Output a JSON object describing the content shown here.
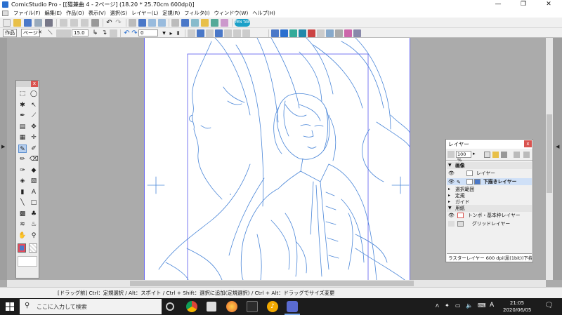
{
  "window": {
    "title": "ComicStudio Pro - [[猫兼曲 4 - 2ページ] (18.20 * 25.70cm 600dpi)]",
    "controls": [
      "—",
      "❐",
      "✕"
    ]
  },
  "menubar": {
    "items": [
      "ファイル(F)",
      "編集(E)",
      "作品(O)",
      "表示(V)",
      "選択(S)",
      "レイヤー(L)",
      "定規(R)",
      "フィルタ(I)",
      "ウィンドウ(W)",
      "ヘルプ(H)"
    ]
  },
  "toolbar": {
    "pentab_label": "PEN TAB",
    "work_tab": "作品",
    "page_tab": "ページ",
    "page_close": "✕",
    "brush_size": "15.0",
    "rotation": "0"
  },
  "tool_palette": {
    "close": "x",
    "tools": [
      {
        "name": "rect-select-icon",
        "glyph": "⬚"
      },
      {
        "name": "lasso-icon",
        "glyph": "◯"
      },
      {
        "name": "magic-wand-icon",
        "glyph": "✱"
      },
      {
        "name": "move-layer-icon",
        "glyph": "↖"
      },
      {
        "name": "pen-icon",
        "glyph": "✒"
      },
      {
        "name": "eyedropper-icon",
        "glyph": "⟋"
      },
      {
        "name": "layer-move-icon",
        "glyph": "▤"
      },
      {
        "name": "object-icon",
        "glyph": "✥"
      },
      {
        "name": "ruler-icon",
        "glyph": "▦"
      },
      {
        "name": "move-icon",
        "glyph": "✛"
      },
      {
        "name": "pencil-icon",
        "glyph": "✎"
      },
      {
        "name": "marker-icon",
        "glyph": "✐"
      },
      {
        "name": "brush-icon",
        "glyph": "✏"
      },
      {
        "name": "eraser-icon",
        "glyph": "⌫"
      },
      {
        "name": "airbrush-icon",
        "glyph": "✑"
      },
      {
        "name": "fill-icon",
        "glyph": "◆"
      },
      {
        "name": "bucket-icon",
        "glyph": "◈"
      },
      {
        "name": "pattern-icon",
        "glyph": "▧"
      },
      {
        "name": "gradient-icon",
        "glyph": "▮"
      },
      {
        "name": "text-icon",
        "glyph": "A"
      },
      {
        "name": "line-icon",
        "glyph": "╲"
      },
      {
        "name": "frame-icon",
        "glyph": "□"
      },
      {
        "name": "tone-icon",
        "glyph": "▩"
      },
      {
        "name": "stamp-icon",
        "glyph": "♣"
      },
      {
        "name": "blur-icon",
        "glyph": "≋"
      },
      {
        "name": "smudge-icon",
        "glyph": "♨"
      },
      {
        "name": "hand-icon",
        "glyph": "✋"
      },
      {
        "name": "zoom-icon",
        "glyph": "⚲"
      }
    ]
  },
  "layer_palette": {
    "title": "レイヤー",
    "close": "x",
    "opacity": "100 %",
    "rows": [
      {
        "label": "画像",
        "kind": "group"
      },
      {
        "label": "レイヤー",
        "kind": "layer"
      },
      {
        "label": "下描きレイヤー",
        "kind": "layer-selected"
      },
      {
        "label": "選択範囲",
        "kind": "group"
      },
      {
        "label": "定規",
        "kind": "group"
      },
      {
        "label": "ガイド",
        "kind": "group"
      },
      {
        "label": "用紙",
        "kind": "group"
      },
      {
        "label": "トンボ・基本枠レイヤー",
        "kind": "layer"
      },
      {
        "label": "グリッドレイヤー",
        "kind": "layer"
      }
    ],
    "status": "ラスターレイヤー 600 dpi(黒(1bit))下描..."
  },
  "statusbar": {
    "text": "[ドラッグ前] Ctrl：定規選択 / Alt：スポイト / Ctrl + Shift：選択に追加(定規選択) / Ctrl + Alt：ドラッグでサイズ変更"
  },
  "taskbar": {
    "search_placeholder": "ここに入力して検索",
    "time": "21:05",
    "date": "2020/06/05",
    "ime": "A"
  },
  "colors": {
    "sketch": "#4a86d8",
    "frame": "#6a6af0",
    "selection": "#cfe0f7",
    "close": "#d9534f"
  }
}
